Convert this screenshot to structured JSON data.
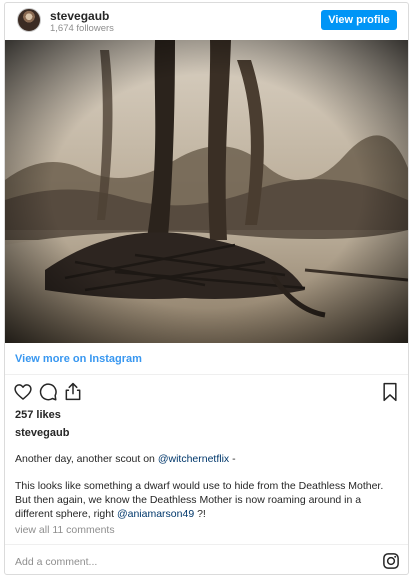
{
  "header": {
    "username": "stevegaub",
    "followers": "1,674 followers",
    "view_profile_label": "View profile"
  },
  "post": {
    "image_icon": "photo-image",
    "view_more_label": "View more on Instagram",
    "likes": "257 likes",
    "caption_username": "stevegaub",
    "caption_line1_prefix": "Another day, another scout on ",
    "caption_line1_mention": "@witchernetflix",
    "caption_line1_suffix": " -",
    "caption_body_prefix": "This looks like something a dwarf would use to hide from the Deathless Mother. But then again, we know the Deathless Mother is now roaming around in a different sphere, right ",
    "caption_body_mention": "@aniamarson49",
    "caption_body_suffix": " ?!",
    "view_comments": "view all 11 comments"
  },
  "comment_box": {
    "placeholder": "Add a comment..."
  },
  "icons": {
    "like": "heart-icon",
    "comment": "comment-icon",
    "share": "share-icon",
    "save": "bookmark-icon",
    "brand": "instagram-icon"
  },
  "colors": {
    "accent": "#0095f6",
    "link": "#3897f0",
    "mention": "#00376b",
    "muted": "#8e8e8e"
  }
}
